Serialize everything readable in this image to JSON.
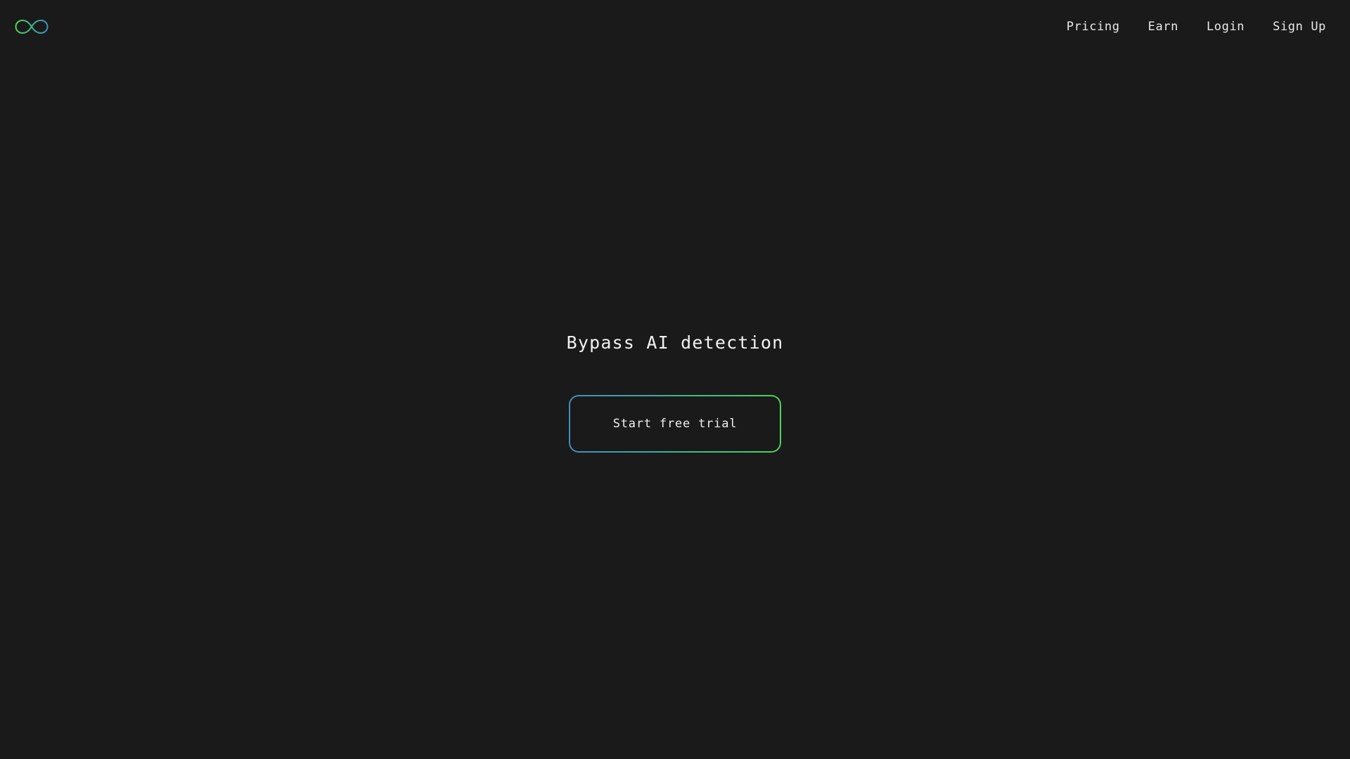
{
  "header": {
    "logo_icon": "infinity-icon",
    "nav": [
      {
        "label": "Pricing"
      },
      {
        "label": "Earn"
      },
      {
        "label": "Login"
      },
      {
        "label": "Sign Up"
      }
    ]
  },
  "hero": {
    "title": "Bypass AI detection",
    "cta_label": "Start free trial"
  },
  "colors": {
    "background": "#1a1a1a",
    "text": "#f0f0f0",
    "accent_gradient_start": "#3f8fc0",
    "accent_gradient_end": "#4ed35a"
  }
}
